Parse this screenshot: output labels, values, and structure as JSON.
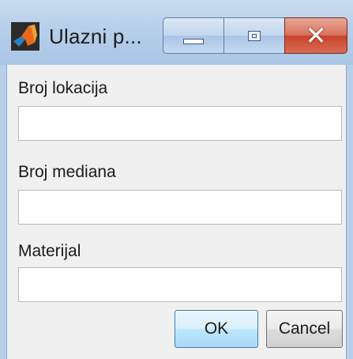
{
  "window": {
    "title": "Ulazni p...",
    "app_icon": "matlab-icon",
    "controls": {
      "minimize": "minimize-icon",
      "maximize": "maximize-icon",
      "close": "close-icon"
    }
  },
  "form": {
    "fields": [
      {
        "label": "Broj lokacija",
        "value": ""
      },
      {
        "label": "Broj mediana",
        "value": ""
      },
      {
        "label": "Materijal",
        "value": ""
      }
    ]
  },
  "buttons": {
    "ok": "OK",
    "cancel": "Cancel"
  }
}
